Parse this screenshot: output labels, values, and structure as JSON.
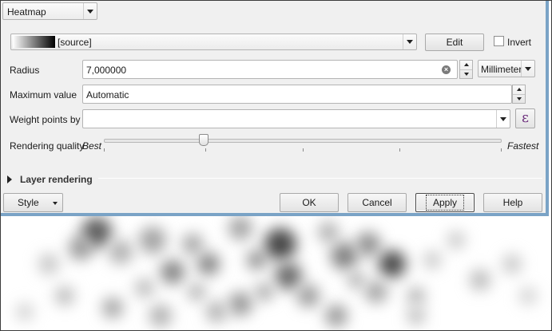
{
  "renderer": {
    "selected": "Heatmap"
  },
  "color_ramp": {
    "label": "[source]",
    "edit_label": "Edit",
    "invert_label": "Invert",
    "invert_checked": false
  },
  "radius": {
    "label": "Radius",
    "value": "7,000000",
    "unit": "Millimeter"
  },
  "max_value": {
    "label": "Maximum value",
    "value": "Automatic"
  },
  "weight": {
    "label": "Weight points by",
    "value": "",
    "expression_symbol": "ε"
  },
  "quality": {
    "label": "Rendering quality",
    "min_label": "Best",
    "max_label": "Fastest",
    "level_fraction": 0.25
  },
  "layer_rendering": {
    "label": "Layer rendering",
    "expanded": false
  },
  "footer": {
    "style_label": "Style",
    "ok_label": "OK",
    "cancel_label": "Cancel",
    "apply_label": "Apply",
    "help_label": "Help"
  },
  "colors": {
    "dialog_bg": "#f0f0f0",
    "border_accent": "#7aa3c6",
    "heat_low": "#ffffff",
    "heat_high": "#000000"
  },
  "icons": [
    "chevron-down-icon",
    "clear-icon",
    "spin-up-icon",
    "spin-down-icon",
    "expression-icon",
    "expand-triangle-icon"
  ]
}
